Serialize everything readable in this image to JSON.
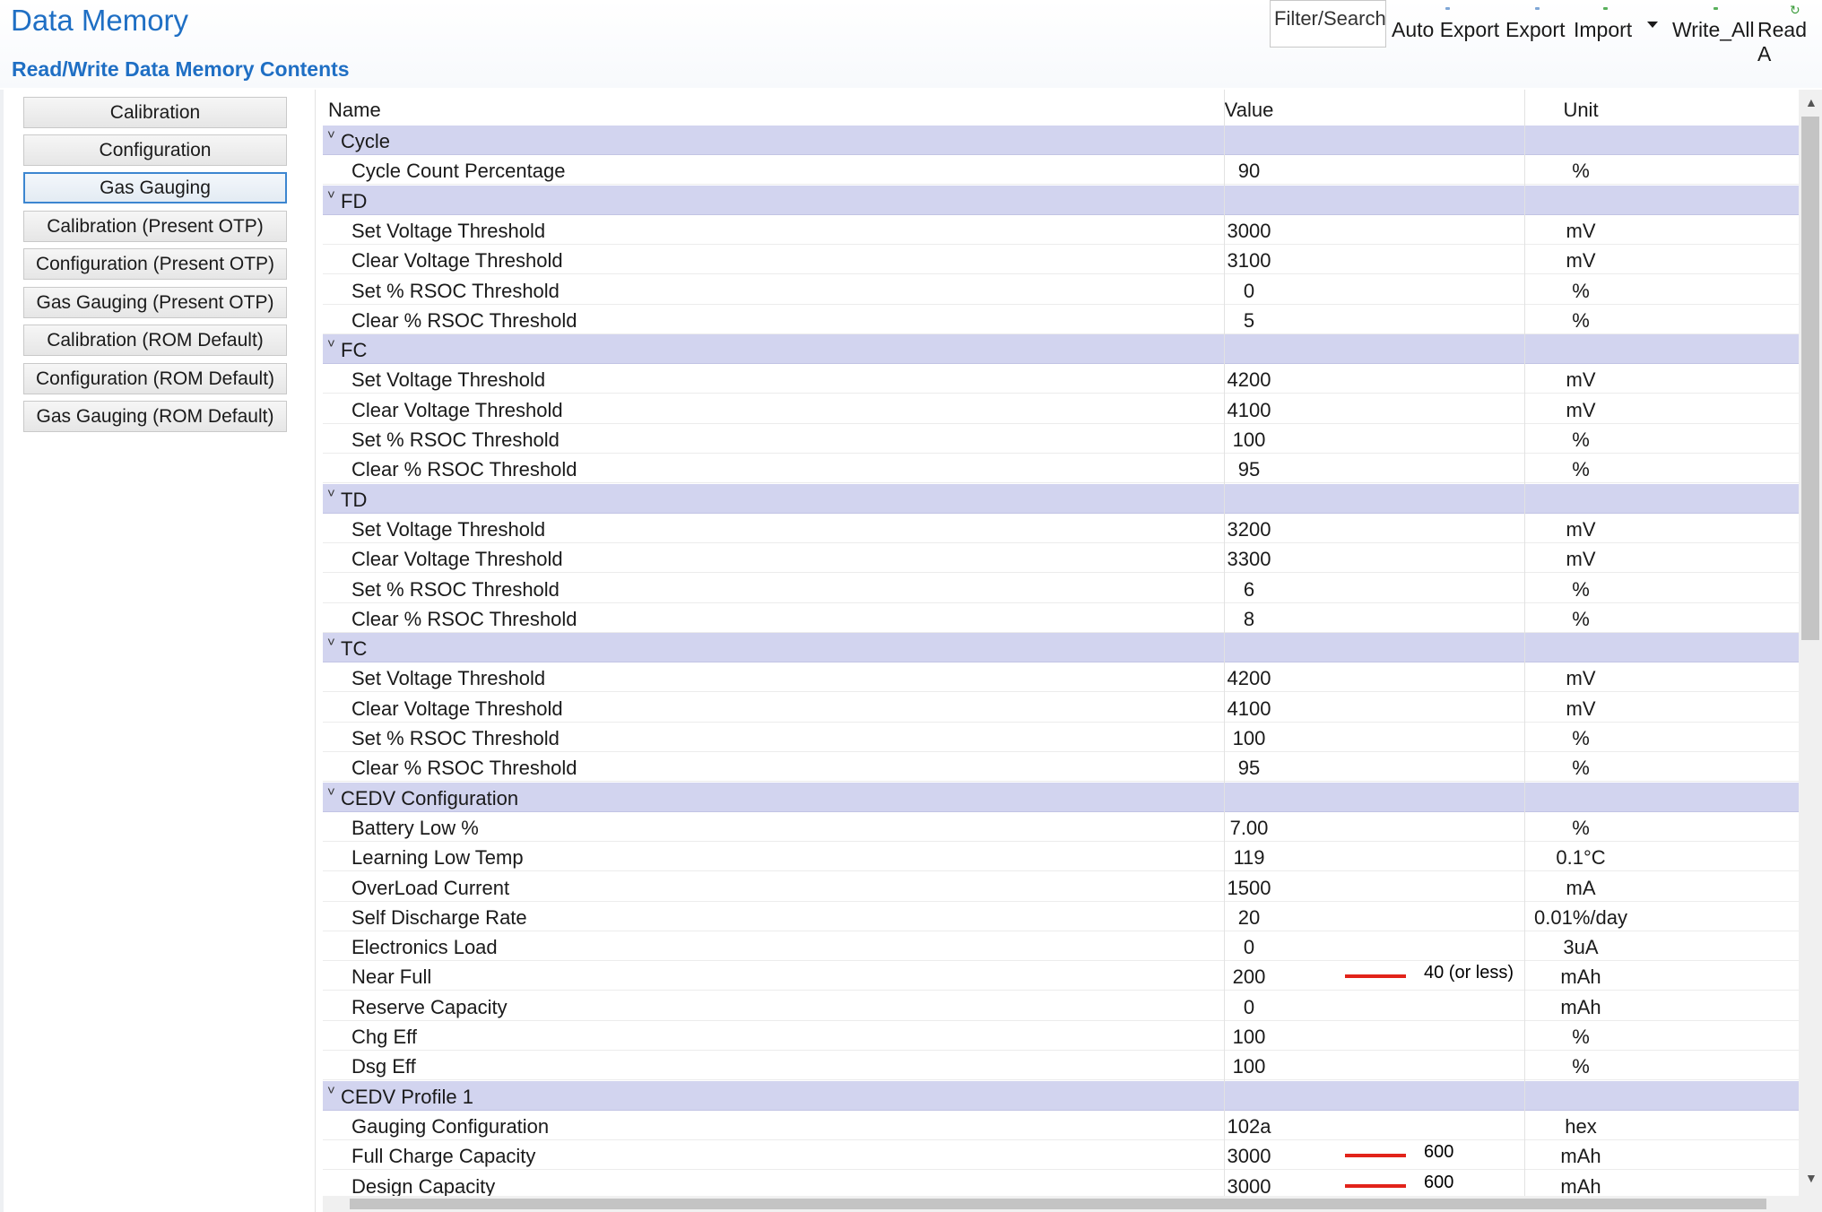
{
  "header": {
    "title": "Data Memory",
    "subtitle": "Read/Write Data Memory Contents",
    "filter_placeholder": "Filter/Search",
    "toolbar": {
      "auto_export": "Auto Export",
      "export": "Export",
      "import": "Import",
      "write_all": "Write_All",
      "read_all": "Read A"
    }
  },
  "nav": {
    "items": [
      "Calibration",
      "Configuration",
      "Gas Gauging",
      "Calibration (Present OTP)",
      "Configuration (Present OTP)",
      "Gas Gauging (Present OTP)",
      "Calibration (ROM Default)",
      "Configuration (ROM Default)",
      "Gas Gauging (ROM Default)"
    ],
    "active": "Gas Gauging"
  },
  "grid": {
    "columns": {
      "name": "Name",
      "value": "Value",
      "unit": "Unit"
    },
    "rows": [
      {
        "type": "group",
        "name": "Cycle"
      },
      {
        "type": "row",
        "name": "Cycle Count Percentage",
        "value": "90",
        "unit": "%"
      },
      {
        "type": "group",
        "name": "FD"
      },
      {
        "type": "row",
        "name": "Set Voltage Threshold",
        "value": "3000",
        "unit": "mV"
      },
      {
        "type": "row",
        "name": "Clear Voltage Threshold",
        "value": "3100",
        "unit": "mV"
      },
      {
        "type": "row",
        "name": "Set % RSOC Threshold",
        "value": "0",
        "unit": "%"
      },
      {
        "type": "row",
        "name": "Clear % RSOC Threshold",
        "value": "5",
        "unit": "%"
      },
      {
        "type": "group",
        "name": "FC"
      },
      {
        "type": "row",
        "name": "Set Voltage Threshold",
        "value": "4200",
        "unit": "mV"
      },
      {
        "type": "row",
        "name": "Clear Voltage Threshold",
        "value": "4100",
        "unit": "mV"
      },
      {
        "type": "row",
        "name": "Set % RSOC Threshold",
        "value": "100",
        "unit": "%"
      },
      {
        "type": "row",
        "name": "Clear % RSOC Threshold",
        "value": "95",
        "unit": "%"
      },
      {
        "type": "group",
        "name": "TD"
      },
      {
        "type": "row",
        "name": "Set Voltage Threshold",
        "value": "3200",
        "unit": "mV"
      },
      {
        "type": "row",
        "name": "Clear Voltage Threshold",
        "value": "3300",
        "unit": "mV"
      },
      {
        "type": "row",
        "name": "Set % RSOC Threshold",
        "value": "6",
        "unit": "%"
      },
      {
        "type": "row",
        "name": "Clear % RSOC Threshold",
        "value": "8",
        "unit": "%"
      },
      {
        "type": "group",
        "name": "TC"
      },
      {
        "type": "row",
        "name": "Set Voltage Threshold",
        "value": "4200",
        "unit": "mV"
      },
      {
        "type": "row",
        "name": "Clear Voltage Threshold",
        "value": "4100",
        "unit": "mV"
      },
      {
        "type": "row",
        "name": "Set % RSOC Threshold",
        "value": "100",
        "unit": "%"
      },
      {
        "type": "row",
        "name": "Clear % RSOC Threshold",
        "value": "95",
        "unit": "%"
      },
      {
        "type": "group",
        "name": "CEDV Configuration"
      },
      {
        "type": "row",
        "name": "Battery Low %",
        "value": "7.00",
        "unit": "%"
      },
      {
        "type": "row",
        "name": "Learning Low Temp",
        "value": "119",
        "unit": "0.1°C"
      },
      {
        "type": "row",
        "name": "OverLoad Current",
        "value": "1500",
        "unit": "mA"
      },
      {
        "type": "row",
        "name": "Self Discharge Rate",
        "value": "20",
        "unit": "0.01%/day"
      },
      {
        "type": "row",
        "name": "Electronics Load",
        "value": "0",
        "unit": "3uA"
      },
      {
        "type": "row",
        "name": "Near Full",
        "value": "200",
        "unit": "mAh",
        "struck": true,
        "note": "40 (or less)"
      },
      {
        "type": "row",
        "name": "Reserve Capacity",
        "value": "0",
        "unit": "mAh"
      },
      {
        "type": "row",
        "name": "Chg Eff",
        "value": "100",
        "unit": "%"
      },
      {
        "type": "row",
        "name": "Dsg Eff",
        "value": "100",
        "unit": "%"
      },
      {
        "type": "group",
        "name": "CEDV Profile 1"
      },
      {
        "type": "row",
        "name": "Gauging Configuration",
        "value": "102a",
        "unit": "hex"
      },
      {
        "type": "row",
        "name": "Full Charge Capacity",
        "value": "3000",
        "unit": "mAh",
        "struck": true,
        "note": "600"
      },
      {
        "type": "row",
        "name": "Design Capacity",
        "value": "3000",
        "unit": "mAh",
        "struck": true,
        "note": "600"
      }
    ]
  },
  "colors": {
    "accent": "#1f6fc4",
    "group_row": "#d2d4ef",
    "strike": "#e2231a"
  }
}
